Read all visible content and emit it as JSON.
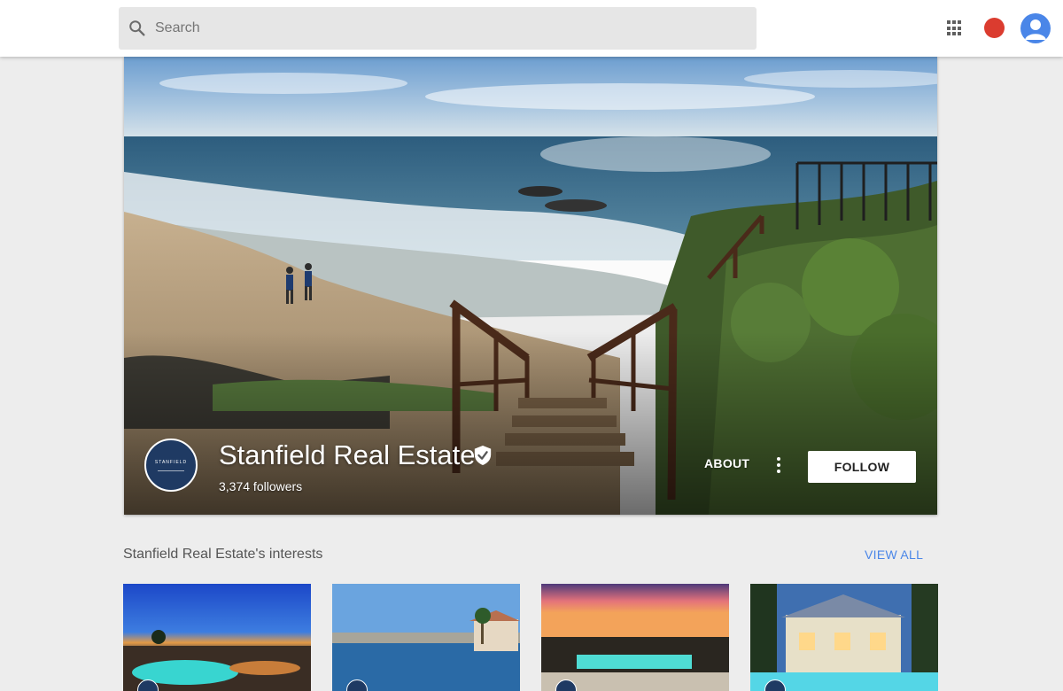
{
  "search": {
    "placeholder": "Search"
  },
  "header": {
    "apps_icon": "apps-grid-icon",
    "notification_color": "#db3c2f",
    "avatar_color": "#4a86e8"
  },
  "profile": {
    "name": "Stanfield Real Estate",
    "followers": "3,374 followers",
    "logo_text": "STANFIELD",
    "verified_icon": "verified-check-icon",
    "about_label": "ABOUT",
    "follow_label": "FOLLOW"
  },
  "interests": {
    "title": "Stanfield Real Estate's interests",
    "view_all_label": "VIEW ALL",
    "cards": [
      {
        "scene": "pool at dusk overlooking city"
      },
      {
        "scene": "harbor with palm trees and homes"
      },
      {
        "scene": "infinity pool at sunset"
      },
      {
        "scene": "mansion with pool"
      }
    ]
  },
  "colors": {
    "accent": "#4a86e8",
    "brand_navy": "#1f3a63",
    "background": "#ededed"
  }
}
